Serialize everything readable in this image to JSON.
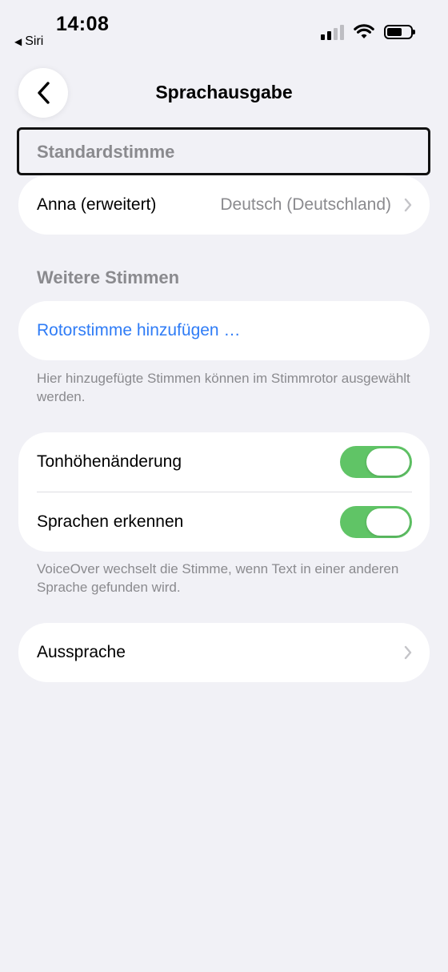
{
  "status_bar": {
    "time": "14:08",
    "back_app": "Siri"
  },
  "nav": {
    "title": "Sprachausgabe"
  },
  "default_voice": {
    "header": "Standardstimme",
    "voice_name": "Anna (erweitert)",
    "voice_language": "Deutsch (Deutschland)"
  },
  "more_voices": {
    "header": "Weitere Stimmen",
    "add_rotor_voice": "Rotorstimme hinzufügen …",
    "footnote": "Hier hinzugefügte Stimmen können im Stimmrotor ausgewählt werden."
  },
  "toggles": {
    "pitch_change": {
      "label": "Tonhöhenänderung",
      "on": true
    },
    "detect_languages": {
      "label": "Sprachen erkennen",
      "on": true
    },
    "footnote": "VoiceOver wechselt die Stimme, wenn Text in einer anderen Sprache gefunden wird."
  },
  "pronunciation": {
    "label": "Aussprache"
  },
  "colors": {
    "background": "#f1f1f6",
    "accent_link": "#2f7cf6",
    "toggle_on": "#60c466",
    "secondary_text": "#8a8a8e"
  }
}
